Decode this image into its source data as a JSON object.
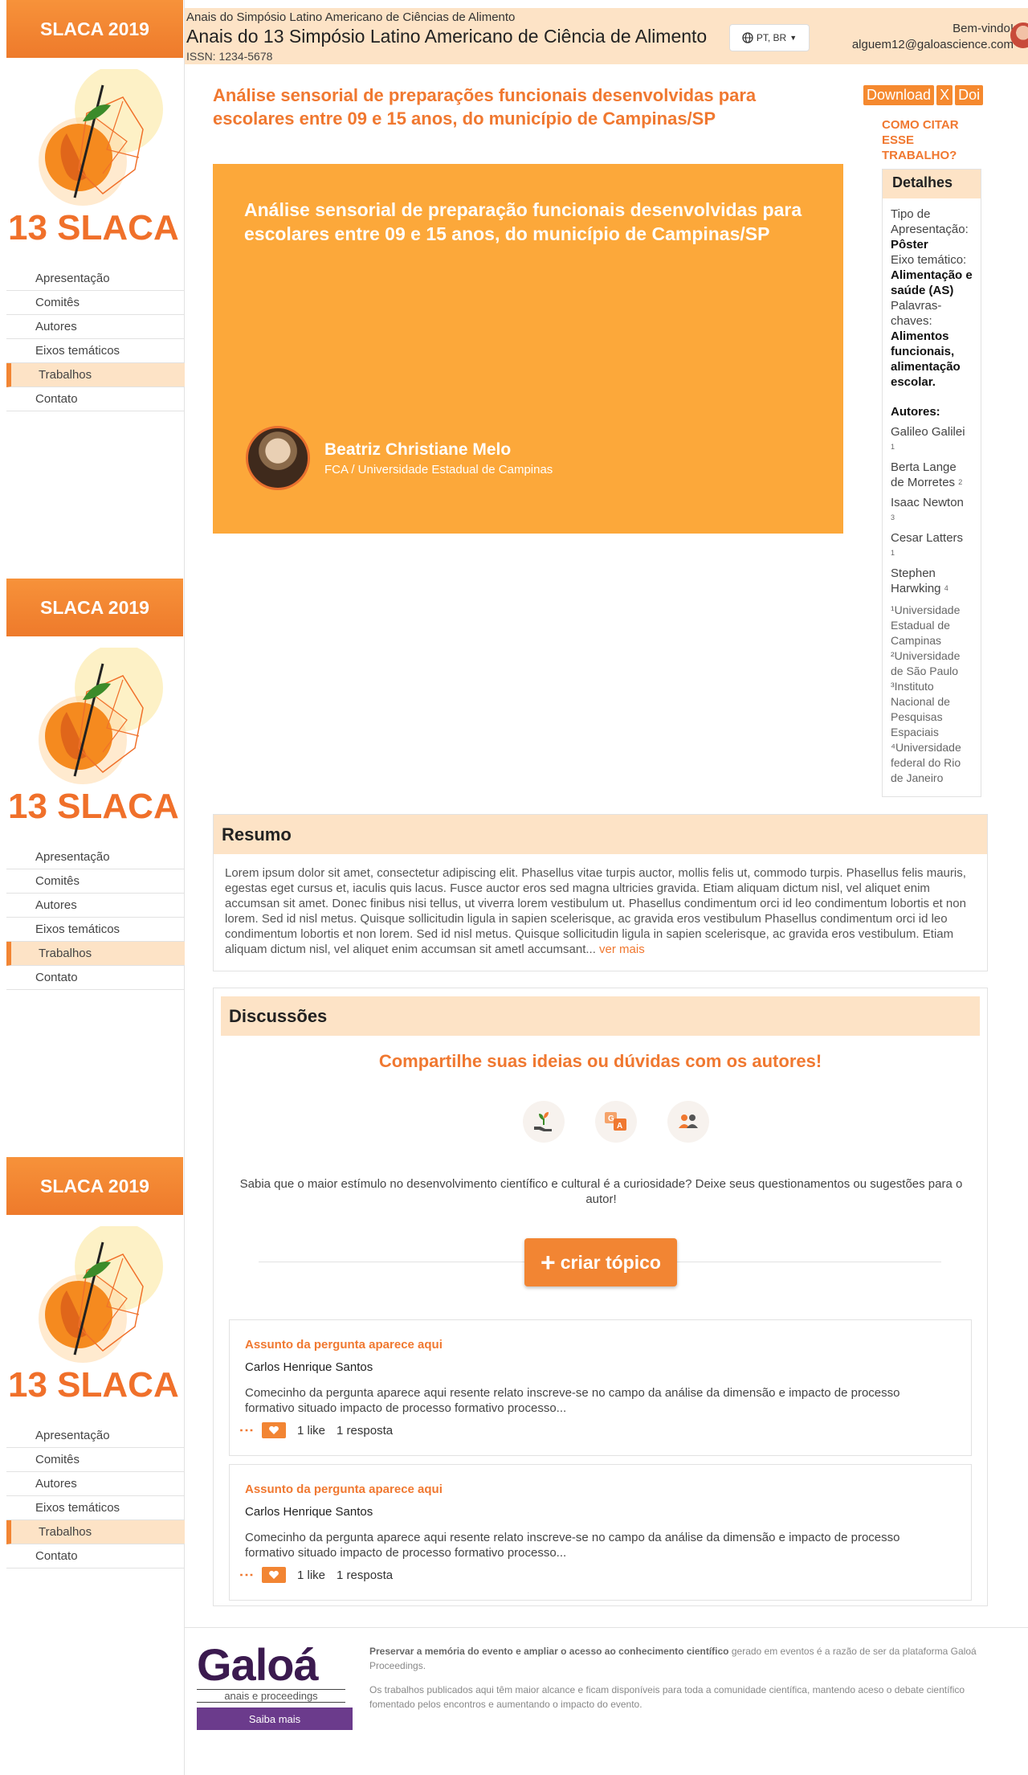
{
  "sidebar": {
    "badge": "SLACA 2019",
    "logo_text": "13 SLACA",
    "menu": [
      "Apresentação",
      "Comitês",
      "Autores",
      "Eixos temáticos",
      "Trabalhos",
      "Contato"
    ]
  },
  "header": {
    "subtitle": "Anais do Simpósio Latino Americano de Ciências de Alimento",
    "title": "Anais do 13 Simpósio Latino Americano de Ciência de Alimento",
    "issn": "ISSN: 1234-5678",
    "language": "PT, BR",
    "welcome": "Bem-vindo!",
    "email": "alguem12@galoascience.com"
  },
  "paper": {
    "title": "Análise sensorial de preparações funcionais desenvolvidas para escolares entre 09 e 15 anos, do município de Campinas/SP",
    "hero_title": "Análise sensorial de preparação funcionais desenvolvidas para escolares entre 09 e 15 anos, do município de Campinas/SP",
    "presenter_name": "Beatriz Christiane Melo",
    "presenter_institution": "FCA / Universidade Estadual de Campinas"
  },
  "actions": {
    "download": "Download",
    "x": "X",
    "doi": "Doi",
    "cite": "COMO CITAR ESSE TRABALHO?"
  },
  "details": {
    "heading": "Detalhes",
    "type_label": "Tipo de Apresentação:",
    "type_value": "Pôster",
    "axis_label": "Eixo temático:",
    "axis_value": "Alimentação e saúde (AS)",
    "keywords_label": "Palavras-chaves:",
    "keywords_value": "Alimentos funcionais, alimentação escolar.",
    "authors_label": "Autores:",
    "authors": [
      {
        "name": "Galileo Galilei",
        "sup": "1"
      },
      {
        "name": "Berta Lange de Morretes",
        "sup": "2"
      },
      {
        "name": "Isaac Newton",
        "sup": "3"
      },
      {
        "name": "Cesar Latters",
        "sup": "1"
      },
      {
        "name": "Stephen Harwking",
        "sup": "4"
      }
    ],
    "affiliations": [
      "¹Universidade Estadual de Campinas",
      "²Universidade de São Paulo",
      "³Instituto Nacional de Pesquisas Espaciais",
      "⁴Universidade federal do Rio de Janeiro"
    ]
  },
  "resumo": {
    "heading": "Resumo",
    "text": "Lorem ipsum dolor sit amet, consectetur adipiscing elit. Phasellus vitae turpis auctor, mollis felis ut, commodo turpis. Phasellus felis mauris, egestas eget cursus et, iaculis quis lacus. Fusce auctor eros sed magna ultricies gravida. Etiam aliquam dictum nisl, vel aliquet enim accumsan sit amet. Donec finibus nisi tellus, ut viverra lorem vestibulum ut. Phasellus condimentum orci id leo condimentum lobortis et non lorem. Sed id nisl metus. Quisque sollicitudin ligula in sapien scelerisque, ac gravida eros vestibulum Phasellus condimentum orci id leo condimentum lobortis et non lorem. Sed id nisl metus. Quisque sollicitudin ligula in sapien scelerisque, ac gravida eros vestibulum. Etiam aliquam dictum nisl, vel aliquet enim accumsan sit ametl accumsant...",
    "more": "ver mais"
  },
  "discussions": {
    "heading": "Discussões",
    "cta": "Compartilhe suas ideias ou dúvidas com os autores!",
    "icons": [
      "plant-hand-icon",
      "translate-icon",
      "people-icon"
    ],
    "description": "Sabia que o maior estímulo no desenvolvimento científico e cultural é a curiosidade? Deixe seus questionamentos ou sugestões para o autor!",
    "create_button": "criar tópico",
    "topics": [
      {
        "title": "Assunto da pergunta aparece aqui",
        "author": "Carlos Henrique Santos",
        "excerpt": "Comecinho da pergunta aparece aqui resente relato inscreve-se no campo da análise da dimensão e impacto de processo formativo situado impacto de processo formativo processo...",
        "likes": "1 like",
        "replies": "1 resposta"
      },
      {
        "title": "Assunto da pergunta aparece aqui",
        "author": "Carlos Henrique Santos",
        "excerpt": "Comecinho da pergunta aparece aqui resente relato inscreve-se no campo da análise da dimensão e impacto de processo formativo situado impacto de processo formativo processo...",
        "likes": "1 like",
        "replies": "1 resposta"
      }
    ]
  },
  "footer": {
    "brand": "Galoá",
    "brand_sub": "anais e proceedings",
    "button": "Saiba mais",
    "text_bold": "Preservar a memória do evento e ampliar o acesso ao conhecimento científico",
    "text_rest": " gerado em eventos é a razão de ser da plataforma Galoá Proceedings.",
    "text2": "Os trabalhos publicados aqui têm maior alcance e ficam disponíveis para toda a comunidade científica, mantendo aceso o debate científico fomentado pelos encontros e aumentando o impacto do evento."
  },
  "colors": {
    "accent": "#f07830",
    "hero": "#fca83a",
    "highlight": "#fde3c6",
    "brand_purple": "#6b3b8c"
  }
}
